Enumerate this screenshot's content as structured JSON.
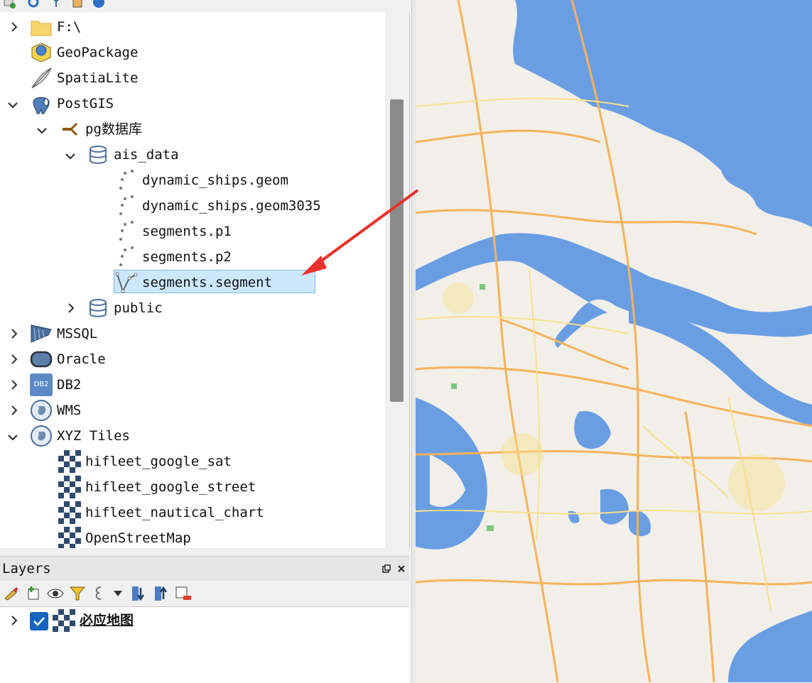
{
  "browser": {
    "items": [
      {
        "label": "F:\\",
        "icon": "folder-icon"
      },
      {
        "label": "GeoPackage",
        "icon": "geopackage-icon"
      },
      {
        "label": "SpatiaLite",
        "icon": "spatialite-feather-icon"
      },
      {
        "label": "PostGIS",
        "icon": "postgis-elephant-icon"
      },
      {
        "label": "pg数据库",
        "icon": "connection-icon"
      },
      {
        "label": "ais_data",
        "icon": "database-schema-icon"
      },
      {
        "label": "dynamic_ships.geom",
        "icon": "point-layer-icon"
      },
      {
        "label": "dynamic_ships.geom3035",
        "icon": "point-layer-icon"
      },
      {
        "label": "segments.p1",
        "icon": "point-layer-icon"
      },
      {
        "label": "segments.p2",
        "icon": "point-layer-icon"
      },
      {
        "label": "segments.segment",
        "icon": "line-layer-icon"
      },
      {
        "label": "public",
        "icon": "database-schema-icon"
      },
      {
        "label": "MSSQL",
        "icon": "mssql-icon"
      },
      {
        "label": "Oracle",
        "icon": "oracle-icon"
      },
      {
        "label": "DB2",
        "icon": "db2-icon"
      },
      {
        "label": "WMS",
        "icon": "globe-icon"
      },
      {
        "label": "XYZ Tiles",
        "icon": "globe-icon"
      },
      {
        "label": "hifleet_google_sat",
        "icon": "xyz-tile-icon"
      },
      {
        "label": "hifleet_google_street",
        "icon": "xyz-tile-icon"
      },
      {
        "label": "hifleet_nautical_chart",
        "icon": "xyz-tile-icon"
      },
      {
        "label": "OpenStreetMap",
        "icon": "xyz-tile-icon"
      }
    ],
    "db2_badge": "DB2"
  },
  "layers": {
    "title": "Layers",
    "items": [
      {
        "label": "必应地图",
        "checked": true,
        "icon": "xyz-tile-icon"
      }
    ]
  },
  "colors": {
    "selection": "#cce8ff",
    "water": "#6a9ee3",
    "land": "#f2efe9",
    "road_major": "#f6b25a",
    "road_minor": "#f7e08c",
    "arrow": "#e8312a"
  }
}
